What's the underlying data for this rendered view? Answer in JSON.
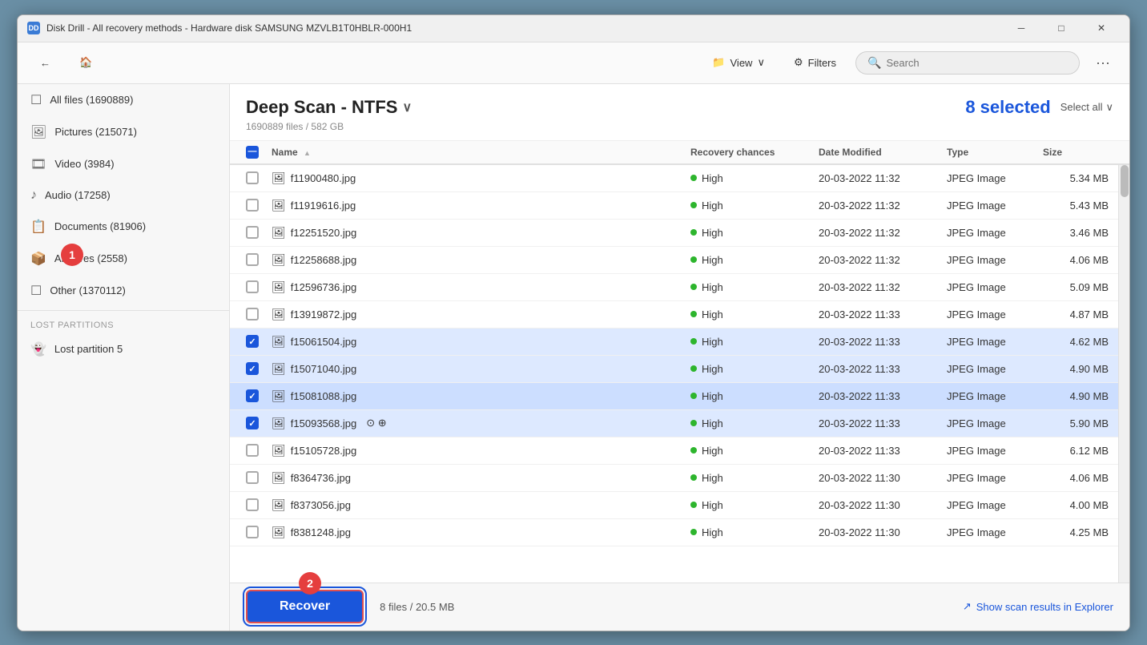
{
  "window": {
    "title": "Disk Drill - All recovery methods - Hardware disk SAMSUNG MZVLB1T0HBLR-000H1",
    "icon": "DD"
  },
  "toolbar": {
    "back_label": "←",
    "home_label": "🏠",
    "view_label": "View",
    "filters_label": "Filters",
    "search_placeholder": "Search",
    "more_label": "···"
  },
  "sidebar": {
    "items": [
      {
        "id": "all-files",
        "label": "All files (1690889)",
        "icon": "☐",
        "active": false
      },
      {
        "id": "pictures",
        "label": "Pictures (215071)",
        "icon": "🖼",
        "active": false
      },
      {
        "id": "video",
        "label": "Video (3984)",
        "icon": "🎞",
        "active": false
      },
      {
        "id": "audio",
        "label": "Audio (17258)",
        "icon": "♪",
        "active": false
      },
      {
        "id": "documents",
        "label": "Documents (81906)",
        "icon": "📋",
        "active": false
      },
      {
        "id": "archives",
        "label": "Archives (2558)",
        "icon": "📦",
        "active": false
      },
      {
        "id": "other",
        "label": "Other (1370112)",
        "icon": "☐",
        "active": false
      }
    ],
    "section_label": "Lost partitions",
    "partition_items": [
      {
        "id": "lost-partition-5",
        "label": "Lost partition 5",
        "icon": "👻"
      }
    ]
  },
  "content": {
    "scan_title": "Deep Scan - NTFS",
    "file_count_label": "1690889 files / 582 GB",
    "selected_count": "8 selected",
    "select_all_label": "Select all"
  },
  "table": {
    "columns": [
      "",
      "Name",
      "Recovery chances",
      "Date Modified",
      "Type",
      "Size"
    ],
    "rows": [
      {
        "name": "f11900480.jpg",
        "checked": false,
        "recovery": "High",
        "date": "20-03-2022 11:32",
        "type": "JPEG Image",
        "size": "5.34 MB",
        "selected": false,
        "highlighted": false
      },
      {
        "name": "f11919616.jpg",
        "checked": false,
        "recovery": "High",
        "date": "20-03-2022 11:32",
        "type": "JPEG Image",
        "size": "5.43 MB",
        "selected": false,
        "highlighted": false
      },
      {
        "name": "f12251520.jpg",
        "checked": false,
        "recovery": "High",
        "date": "20-03-2022 11:32",
        "type": "JPEG Image",
        "size": "3.46 MB",
        "selected": false,
        "highlighted": false
      },
      {
        "name": "f12258688.jpg",
        "checked": false,
        "recovery": "High",
        "date": "20-03-2022 11:32",
        "type": "JPEG Image",
        "size": "4.06 MB",
        "selected": false,
        "highlighted": false
      },
      {
        "name": "f12596736.jpg",
        "checked": false,
        "recovery": "High",
        "date": "20-03-2022 11:32",
        "type": "JPEG Image",
        "size": "5.09 MB",
        "selected": false,
        "highlighted": false
      },
      {
        "name": "f13919872.jpg",
        "checked": false,
        "recovery": "High",
        "date": "20-03-2022 11:33",
        "type": "JPEG Image",
        "size": "4.87 MB",
        "selected": false,
        "highlighted": false
      },
      {
        "name": "f15061504.jpg",
        "checked": true,
        "recovery": "High",
        "date": "20-03-2022 11:33",
        "type": "JPEG Image",
        "size": "4.62 MB",
        "selected": true,
        "highlighted": false
      },
      {
        "name": "f15071040.jpg",
        "checked": true,
        "recovery": "High",
        "date": "20-03-2022 11:33",
        "type": "JPEG Image",
        "size": "4.90 MB",
        "selected": true,
        "highlighted": false
      },
      {
        "name": "f15081088.jpg",
        "checked": true,
        "recovery": "High",
        "date": "20-03-2022 11:33",
        "type": "JPEG Image",
        "size": "4.90 MB",
        "selected": true,
        "highlighted": true
      },
      {
        "name": "f15093568.jpg",
        "checked": true,
        "recovery": "High",
        "date": "20-03-2022 11:33",
        "type": "JPEG Image",
        "size": "5.90 MB",
        "selected": true,
        "highlighted": false,
        "has_icons": true
      },
      {
        "name": "f15105728.jpg",
        "checked": false,
        "recovery": "High",
        "date": "20-03-2022 11:33",
        "type": "JPEG Image",
        "size": "6.12 MB",
        "selected": false,
        "highlighted": false
      },
      {
        "name": "f8364736.jpg",
        "checked": false,
        "recovery": "High",
        "date": "20-03-2022 11:30",
        "type": "JPEG Image",
        "size": "4.06 MB",
        "selected": false,
        "highlighted": false
      },
      {
        "name": "f8373056.jpg",
        "checked": false,
        "recovery": "High",
        "date": "20-03-2022 11:30",
        "type": "JPEG Image",
        "size": "4.00 MB",
        "selected": false,
        "highlighted": false
      },
      {
        "name": "f8381248.jpg",
        "checked": false,
        "recovery": "High",
        "date": "20-03-2022 11:30",
        "type": "JPEG Image",
        "size": "4.25 MB",
        "selected": false,
        "highlighted": false
      }
    ]
  },
  "bottom": {
    "recover_label": "Recover",
    "files_summary": "8 files / 20.5 MB",
    "show_explorer_label": "Show scan results in Explorer"
  },
  "badges": {
    "badge1_label": "1",
    "badge2_label": "2"
  }
}
